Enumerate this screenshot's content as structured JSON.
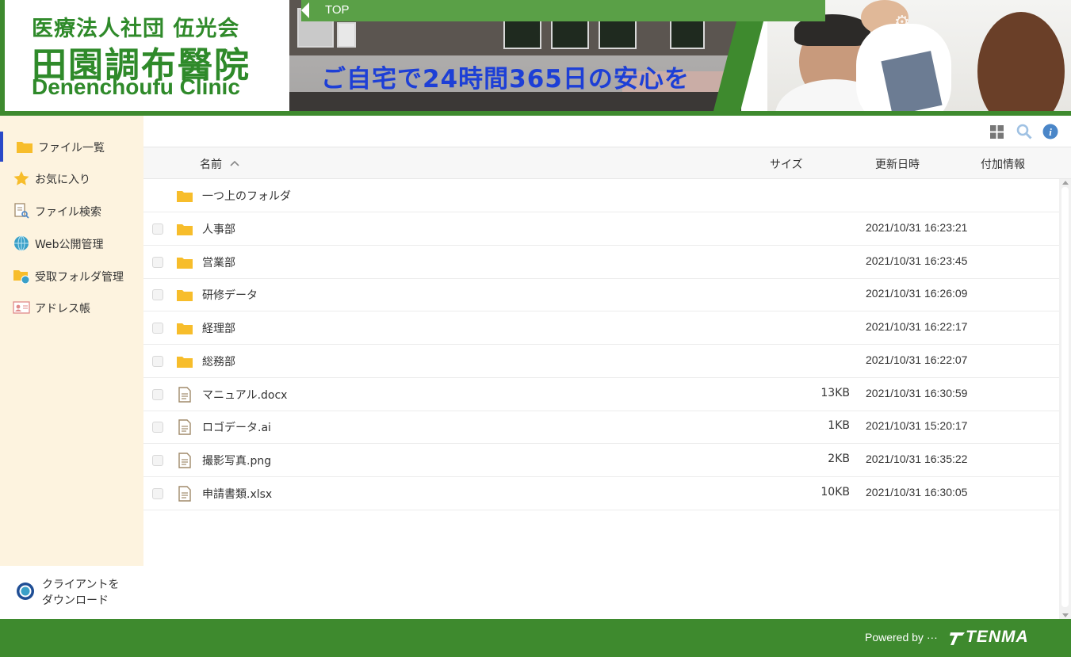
{
  "header": {
    "org_name": "医療法人社団 伍光会",
    "clinic_name_jp": "田園調布醫院",
    "clinic_name_en": "Denenchoufu Clinic",
    "slogan": "ご自宅で24時間365日の安心を",
    "top_link": "TOP"
  },
  "sidebar": {
    "items": [
      {
        "label": "ファイル一覧",
        "icon": "folder-icon",
        "active": true
      },
      {
        "label": "お気に入り",
        "icon": "star-icon"
      },
      {
        "label": "ファイル検索",
        "icon": "file-search-icon"
      },
      {
        "label": "Web公開管理",
        "icon": "globe-icon"
      },
      {
        "label": "受取フォルダ管理",
        "icon": "folder-globe-icon"
      },
      {
        "label": "アドレス帳",
        "icon": "address-book-icon"
      }
    ],
    "download_line1": "クライアントを",
    "download_line2": "ダウンロード"
  },
  "toolbar": {
    "icons": [
      "grid-view-icon",
      "search-icon",
      "info-icon"
    ]
  },
  "table": {
    "columns": {
      "name": "名前",
      "size": "サイズ",
      "modified": "更新日時",
      "extra": "付加情報"
    },
    "sort_icon": "sort-ascending-icon",
    "parent_folder": "一つ上のフォルダ",
    "rows": [
      {
        "name": "人事部",
        "type": "folder",
        "size": "",
        "modified": "2021/10/31 16:23:21"
      },
      {
        "name": "営業部",
        "type": "folder",
        "size": "",
        "modified": "2021/10/31 16:23:45"
      },
      {
        "name": "研修データ",
        "type": "folder",
        "size": "",
        "modified": "2021/10/31 16:26:09"
      },
      {
        "name": "経理部",
        "type": "folder",
        "size": "",
        "modified": "2021/10/31 16:22:17"
      },
      {
        "name": "総務部",
        "type": "folder",
        "size": "",
        "modified": "2021/10/31 16:22:07"
      },
      {
        "name": "マニュアル.docx",
        "type": "file",
        "size": "13KB",
        "modified": "2021/10/31 16:30:59"
      },
      {
        "name": "ロゴデータ.ai",
        "type": "file",
        "size": "1KB",
        "modified": "2021/10/31 15:20:17"
      },
      {
        "name": "撮影写真.png",
        "type": "file",
        "size": "2KB",
        "modified": "2021/10/31 16:35:22"
      },
      {
        "name": "申請書類.xlsx",
        "type": "file",
        "size": "10KB",
        "modified": "2021/10/31 16:30:05"
      }
    ]
  },
  "footer": {
    "powered_by": "Powered by ···",
    "brand": "TENMA"
  },
  "colors": {
    "brand_green": "#3e8a2e",
    "sidebar_bg": "#fdf3df",
    "folder_yellow": "#f7bd2b",
    "active_accent": "#2a49c8",
    "info_blue": "#4a86c8",
    "slogan_blue": "#1d3fd6"
  }
}
